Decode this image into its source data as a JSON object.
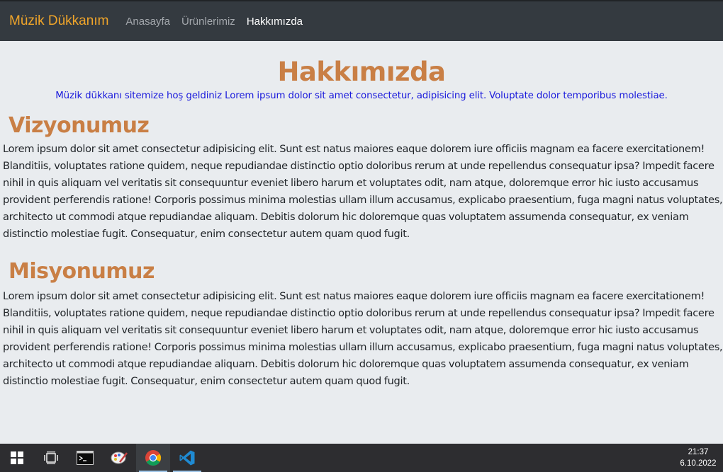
{
  "navbar": {
    "brand": "Müzik Dükkanım",
    "links": [
      {
        "label": "Anasayfa",
        "active": false
      },
      {
        "label": "Ürünlerimiz",
        "active": false
      },
      {
        "label": "Hakkımızda",
        "active": true
      }
    ]
  },
  "main": {
    "title": "Hakkımızda",
    "intro": "Müzik dükkanı sitemize hoş geldiniz Lorem ipsum dolor sit amet consectetur, adipisicing elit. Voluptate dolor temporibus molestiae.",
    "vision": {
      "heading": "Vizyonumuz",
      "text": "Lorem ipsum dolor sit amet consectetur adipisicing elit. Sunt est natus maiores eaque dolorem iure officiis magnam ea facere exercitationem! Blanditiis, voluptates ratione quidem, neque repudiandae distinctio optio doloribus rerum at unde repellendus consequatur ipsa? Impedit facere nihil in quis aliquam vel veritatis sit consequuntur eveniet libero harum et voluptates odit, nam atque, doloremque error hic iusto accusamus provident perferendis ratione! Corporis possimus minima molestias ullam illum accusamus, explicabo praesentium, fuga magni natus voluptates, architecto ut commodi atque repudiandae aliquam. Debitis dolorum hic doloremque quas voluptatem assumenda consequatur, ex veniam distinctio molestiae fugit. Consequatur, enim consectetur autem quam quod fugit."
    },
    "mission": {
      "heading": "Misyonumuz",
      "text": "Lorem ipsum dolor sit amet consectetur adipisicing elit. Sunt est natus maiores eaque dolorem iure officiis magnam ea facere exercitationem! Blanditiis, voluptates ratione quidem, neque repudiandae distinctio optio doloribus rerum at unde repellendus consequatur ipsa? Impedit facere nihil in quis aliquam vel veritatis sit consequuntur eveniet libero harum et voluptates odit, nam atque, doloremque error hic iusto accusamus provident perferendis ratione! Corporis possimus minima molestias ullam illum accusamus, explicabo praesentium, fuga magni natus voluptates, architecto ut commodi atque repudiandae aliquam. Debitis dolorum hic doloremque quas voluptatem assumenda consequatur, ex veniam distinctio molestiae fugit. Consequatur, enim consectetur autem quam quod fugit."
    }
  },
  "taskbar": {
    "icons": [
      "windows-start-icon",
      "task-view-icon",
      "terminal-icon",
      "paint-icon",
      "chrome-icon",
      "vscode-icon"
    ],
    "time": "21:37",
    "date": "6.10.2022"
  },
  "colors": {
    "navbar_bg": "#343a40",
    "brand": "#f0a52a",
    "heading": "#c97f45",
    "intro": "#1a1adc",
    "page_bg": "#e9ecef"
  }
}
